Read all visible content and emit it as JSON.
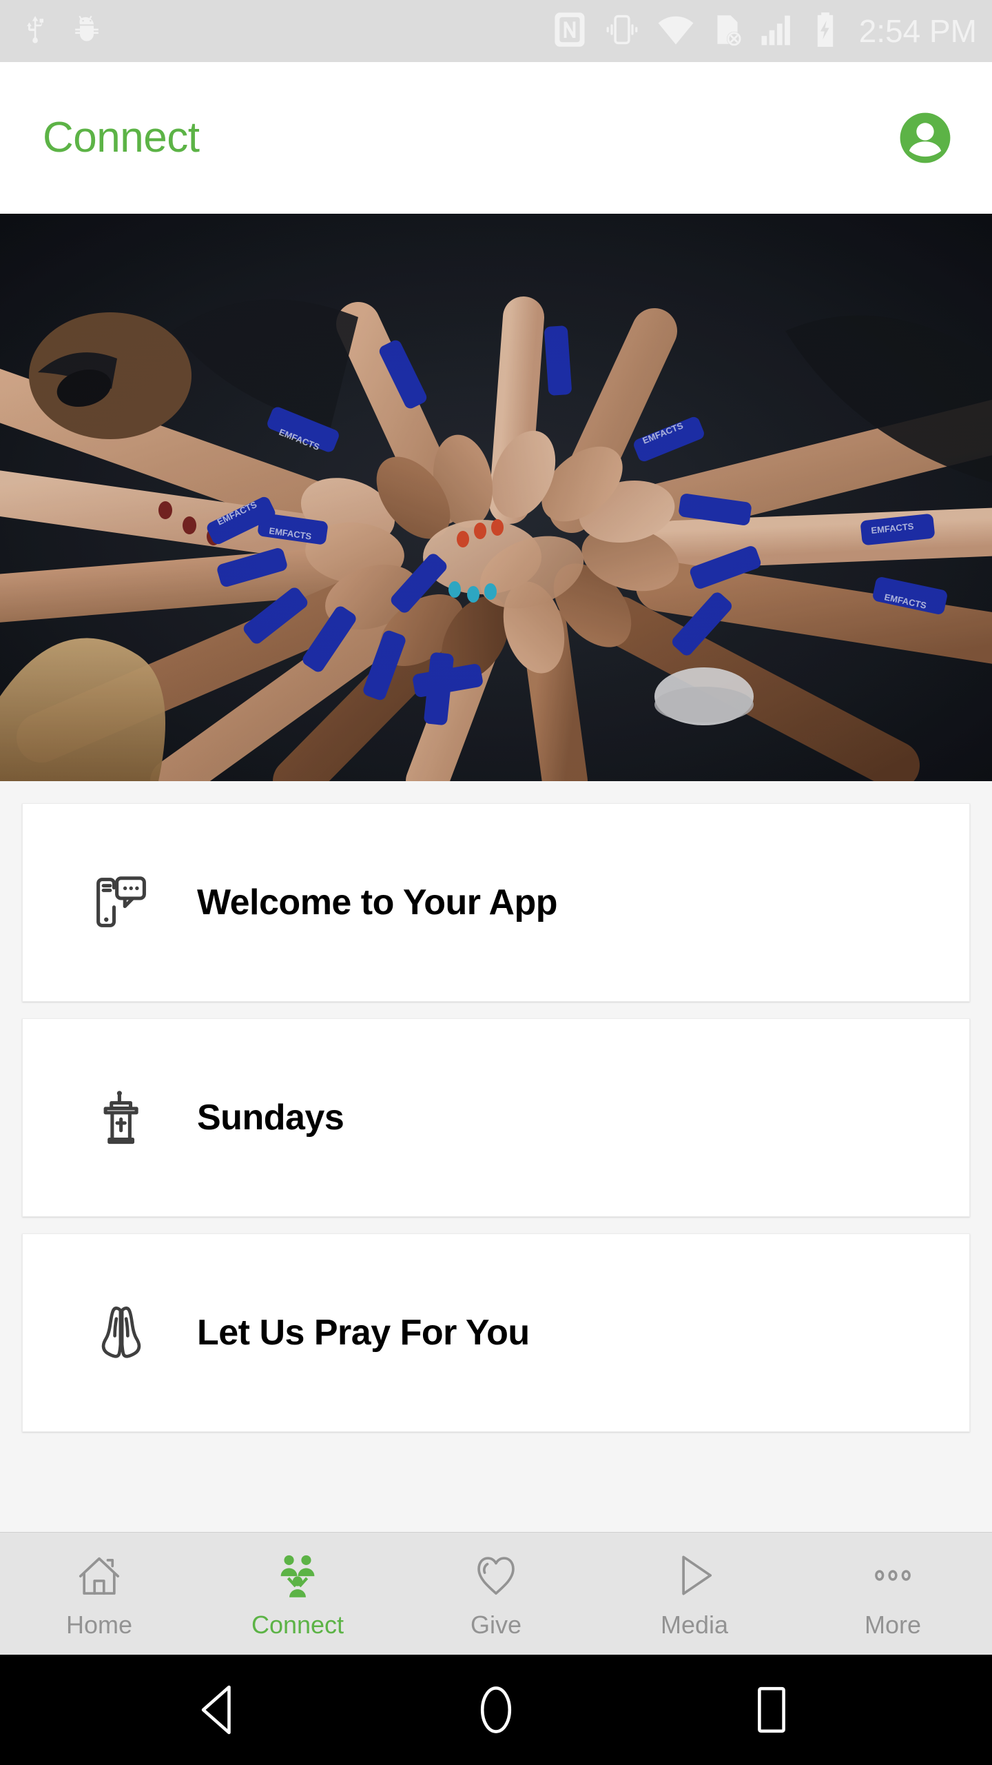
{
  "status_bar": {
    "background": "#dcdcdc",
    "icon_color": "#f2f2f2",
    "time": "2:54 PM",
    "left_icons": [
      {
        "name": "usb-icon",
        "label": "USB connected"
      },
      {
        "name": "android-debug-icon",
        "label": "USB debugging"
      }
    ],
    "right_icons": [
      {
        "name": "nfc-icon",
        "label": "NFC"
      },
      {
        "name": "vibrate-icon",
        "label": "Vibrate mode"
      },
      {
        "name": "wifi-icon",
        "label": "Wi-Fi"
      },
      {
        "name": "no-sim-icon",
        "label": "No SIM card"
      },
      {
        "name": "signal-bars-icon",
        "label": "Mobile signal"
      },
      {
        "name": "battery-charging-icon",
        "label": "Battery charging"
      }
    ]
  },
  "app_bar": {
    "title": "Connect",
    "title_color": "#5cb346",
    "avatar_icon": "account-circle-icon",
    "avatar_color": "#5cb346"
  },
  "hero": {
    "alt": "Group of people placing hands together in a circle wearing blue wristbands",
    "background_color": "#171a20",
    "wristband_color": "#1d2fb5"
  },
  "content": {
    "background": "#f5f5f5",
    "cards": [
      {
        "icon": "phone-chat-icon",
        "label": "Welcome to Your App"
      },
      {
        "icon": "pulpit-icon",
        "label": "Sundays"
      },
      {
        "icon": "praying-hands-icon",
        "label": "Let Us Pray For You"
      }
    ]
  },
  "bottom_nav": {
    "background": "#e4e4e4",
    "inactive_color": "#939393",
    "active_color": "#5cb346",
    "items": [
      {
        "icon": "home-icon",
        "label": "Home",
        "active": false
      },
      {
        "icon": "people-group-icon",
        "label": "Connect",
        "active": true
      },
      {
        "icon": "heart-icon",
        "label": "Give",
        "active": false
      },
      {
        "icon": "play-triangle-icon",
        "label": "Media",
        "active": false
      },
      {
        "icon": "more-dots-icon",
        "label": "More",
        "active": false
      }
    ]
  },
  "android_nav": {
    "background": "#000000",
    "buttons": [
      {
        "icon": "back-triangle-icon",
        "label": "Back"
      },
      {
        "icon": "home-circle-icon",
        "label": "Home"
      },
      {
        "icon": "recents-square-icon",
        "label": "Recent apps"
      }
    ]
  }
}
